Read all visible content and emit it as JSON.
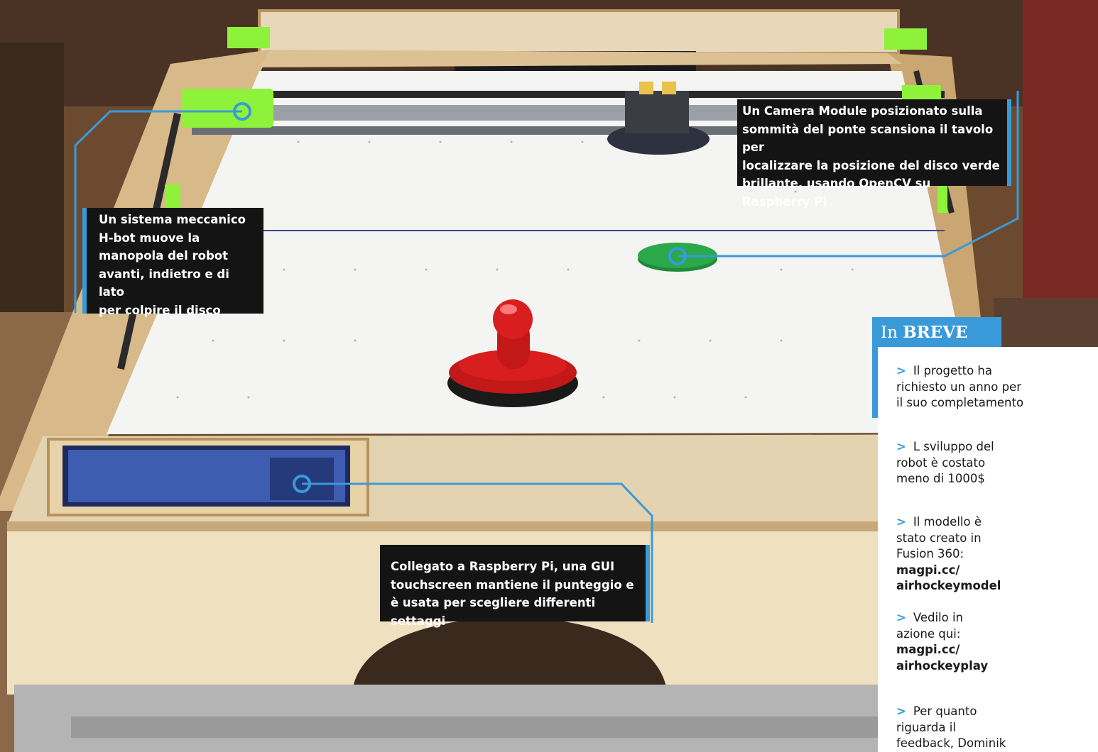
{
  "callouts": {
    "hbot": "Un sistema meccanico\nH-bot muove la\nmanopola del robot\navanti, indietro e di lato\nper colpire il disco",
    "camera": "Un Camera Module posizionato sulla\nsommità del ponte scansiona il tavolo per\nlocalizzare la posizione del disco verde\nbrillante, usando OpenCV su Raspberry Pi",
    "gui": "Collegato a Raspberry Pi, una GUI\ntouchscreen mantiene il punteggio e\nè usata per scegliere differenti settaggi"
  },
  "breve": {
    "title_prefix": "In",
    "title_bold": "BREVE",
    "items": [
      {
        "arrow": ">",
        "text": "Il progetto ha\nrichiesto un anno per\nil suo completamento"
      },
      {
        "arrow": ">",
        "text": "L sviluppo del\nrobot è costato\nmeno di 1000$"
      },
      {
        "arrow": ">",
        "text": "Il modello è\nstato creato in\nFusion 360:",
        "link": "magpi.cc/\nairhockeymodel"
      },
      {
        "arrow": ">",
        "text": "Vedilo in\nazione qui:",
        "link": "magpi.cc/\nairhockeyplay"
      },
      {
        "arrow": ">",
        "text": "Per quanto\nriguarda il\nfeedback, Dominik"
      }
    ]
  },
  "colors": {
    "accent": "#3a9ad9",
    "puck": "#2aa84a",
    "mallet": "#d81e1e",
    "frame_green": "#8ef23a"
  }
}
